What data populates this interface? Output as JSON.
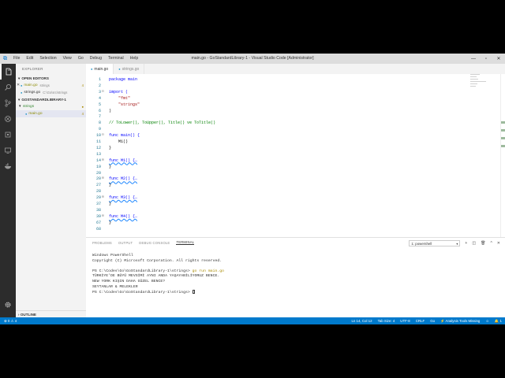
{
  "window": {
    "title": "main.go - GoStandardLibrary-1 - Visual Studio Code [Administrator]",
    "menu": [
      "File",
      "Edit",
      "Selection",
      "View",
      "Go",
      "Debug",
      "Terminal",
      "Help"
    ],
    "controls": {
      "minimize": "—",
      "maximize": "▫",
      "close": "✕"
    }
  },
  "sidebar": {
    "header": "EXPLORER",
    "open_editors": {
      "title": "OPEN EDITORS",
      "items": [
        {
          "name": "main.go",
          "dir": "strings",
          "count": "4",
          "close": "✕"
        },
        {
          "name": "strings.go",
          "dir": "C:\\Go\\src\\strings",
          "count": ""
        }
      ]
    },
    "workspace": {
      "title": "GOSTANDARDLIBRARY-1",
      "folder": "strings",
      "folder_dot": "●",
      "file": "main.go",
      "file_count": "4"
    },
    "outline": "OUTLINE"
  },
  "tabs": [
    {
      "label": "main.go",
      "active": true
    },
    {
      "label": "strings.go",
      "active": false
    }
  ],
  "editor": {
    "lines": [
      {
        "n": "1",
        "fold": "",
        "html": "package main"
      },
      {
        "n": "2",
        "fold": "",
        "html": ""
      },
      {
        "n": "3",
        "fold": "⊟",
        "html": "import ("
      },
      {
        "n": "4",
        "fold": "",
        "html": "    \"fmt\""
      },
      {
        "n": "5",
        "fold": "",
        "html": "    \"strings\""
      },
      {
        "n": "6",
        "fold": "",
        "html": ")"
      },
      {
        "n": "7",
        "fold": "",
        "html": ""
      },
      {
        "n": "8",
        "fold": "",
        "html": "// ToLower(), ToUpper(), Title() ve ToTitle()"
      },
      {
        "n": "9",
        "fold": "",
        "html": ""
      },
      {
        "n": "10",
        "fold": "⊟",
        "html": "func main() {"
      },
      {
        "n": "11",
        "fold": "",
        "html": "    M1()"
      },
      {
        "n": "12",
        "fold": "",
        "html": "}"
      },
      {
        "n": "13",
        "fold": "",
        "html": ""
      },
      {
        "n": "14",
        "fold": "⊞",
        "html": "func M1() {…"
      },
      {
        "n": "19",
        "fold": "",
        "html": "}"
      },
      {
        "n": "20",
        "fold": "",
        "html": ""
      },
      {
        "n": "20",
        "fold": "⊞",
        "html": "func M2() {…"
      },
      {
        "n": "27",
        "fold": "",
        "html": "}"
      },
      {
        "n": "28",
        "fold": "",
        "html": ""
      },
      {
        "n": "29",
        "fold": "⊞",
        "html": "func M3() {…"
      },
      {
        "n": "37",
        "fold": "",
        "html": "}"
      },
      {
        "n": "38",
        "fold": "",
        "html": ""
      },
      {
        "n": "39",
        "fold": "⊞",
        "html": "func M4() {…"
      },
      {
        "n": "67",
        "fold": "",
        "html": "}"
      },
      {
        "n": "68",
        "fold": "",
        "html": ""
      }
    ]
  },
  "panel": {
    "tabs": [
      "PROBLEMS",
      "OUTPUT",
      "DEBUG CONSOLE",
      "TERMINAL"
    ],
    "active_tab": "TERMINAL",
    "terminal_select": "1: powershell",
    "icons": {
      "add": "+",
      "split": "◫",
      "trash": "🗑",
      "up": "^",
      "close": "✕"
    },
    "terminal_lines": [
      "Windows PowerShell",
      "Copyright (C) Microsoft Corporation. All rights reserved.",
      "",
      "PS C:\\Codes\\Go\\GoStandardLibrary-1\\strings> ",
      "TÜRKİYE'DE BÜYÜ MEVSİMİ AYNI ANDA YAŞAYABİLİYORUZ BENCE.",
      "NEW YORK KIŞIN DAHA GÜZEL BENCE?",
      "SEYTANLAR & MELEKLER",
      "PS C:\\Codes\\Go\\GoStandardLibrary-1\\strings> "
    ],
    "command": "go run main.go"
  },
  "status": {
    "problems": "⊗ 0 ⚠ 4",
    "position": "Ln 14, Col 12",
    "tab_size": "Tab Size: 4",
    "encoding": "UTF-8",
    "eol": "CRLF",
    "language": "Go",
    "analysis": "⚡ Analysis Tools Missing",
    "feedback": "☺",
    "bell": "🔔 1"
  },
  "colors": {
    "accent": "#007acc",
    "activity_bar": "#2c2c2c",
    "sidebar": "#f3f3f3",
    "titlebar": "#dddddd"
  }
}
